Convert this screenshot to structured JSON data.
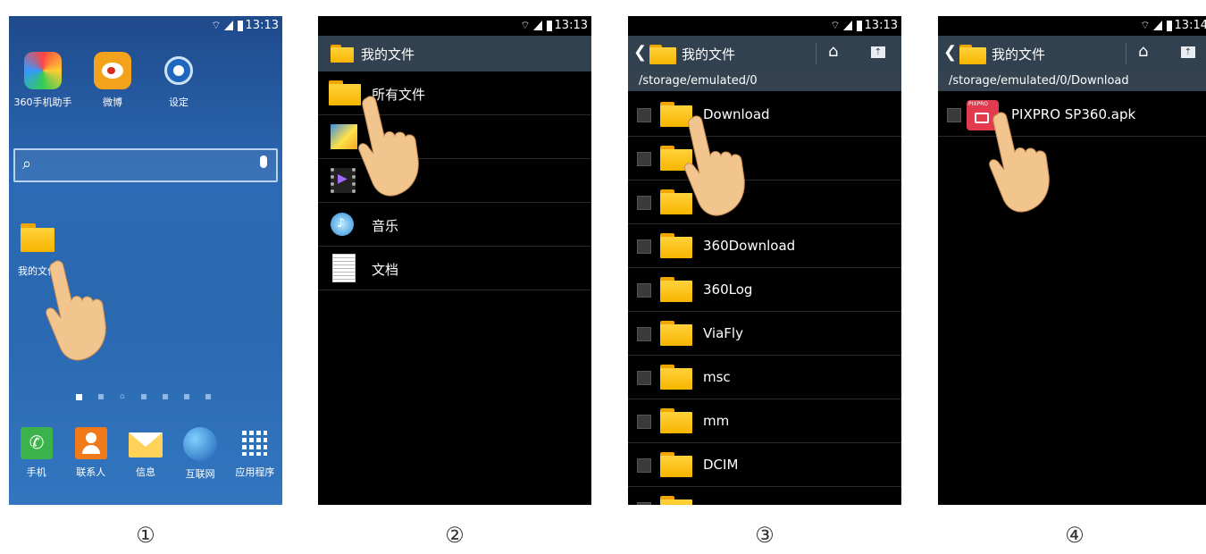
{
  "status_bar": {
    "time_1": "13:13",
    "time_2": "13:13",
    "time_3": "13:13",
    "time_4": "13:14"
  },
  "captions": [
    "①",
    "②",
    "③",
    "④"
  ],
  "screen1": {
    "top_apps": [
      {
        "label": "360手机助手",
        "icon": "360-assistant-icon",
        "color": "#3cb54a"
      },
      {
        "label": "微博",
        "icon": "weibo-icon",
        "color": "#f2a21b"
      },
      {
        "label": "设定",
        "icon": "settings-gear-icon",
        "color": "#2f7fd1"
      }
    ],
    "folder_label": "我的文件",
    "dock": [
      {
        "label": "手机",
        "icon": "phone-icon"
      },
      {
        "label": "联系人",
        "icon": "contacts-icon"
      },
      {
        "label": "信息",
        "icon": "messages-icon"
      },
      {
        "label": "互联网",
        "icon": "internet-globe-icon"
      },
      {
        "label": "应用程序",
        "icon": "apps-grid-icon"
      }
    ]
  },
  "screen2": {
    "title": "我的文件",
    "items": [
      {
        "label": "所有文件",
        "icon": "folder-icon"
      },
      {
        "label": "",
        "icon": "images-icon"
      },
      {
        "label": "",
        "icon": "video-icon"
      },
      {
        "label": "音乐",
        "icon": "music-icon"
      },
      {
        "label": "文档",
        "icon": "document-icon"
      }
    ]
  },
  "screen3": {
    "title": "我的文件",
    "path": "/storage/emulated/0",
    "items": [
      "Download",
      "",
      "",
      "360Download",
      "360Log",
      "ViaFly",
      "msc",
      "mm",
      "DCIM"
    ]
  },
  "screen4": {
    "title": "我的文件",
    "path": "/storage/emulated/0/Download",
    "file": "PIXPRO SP360.apk",
    "apk_icon_text": "PIXPRO"
  },
  "colors": {
    "appbar": "#32414f",
    "folder": "#f7b500",
    "accent": "#2f7fd1"
  }
}
